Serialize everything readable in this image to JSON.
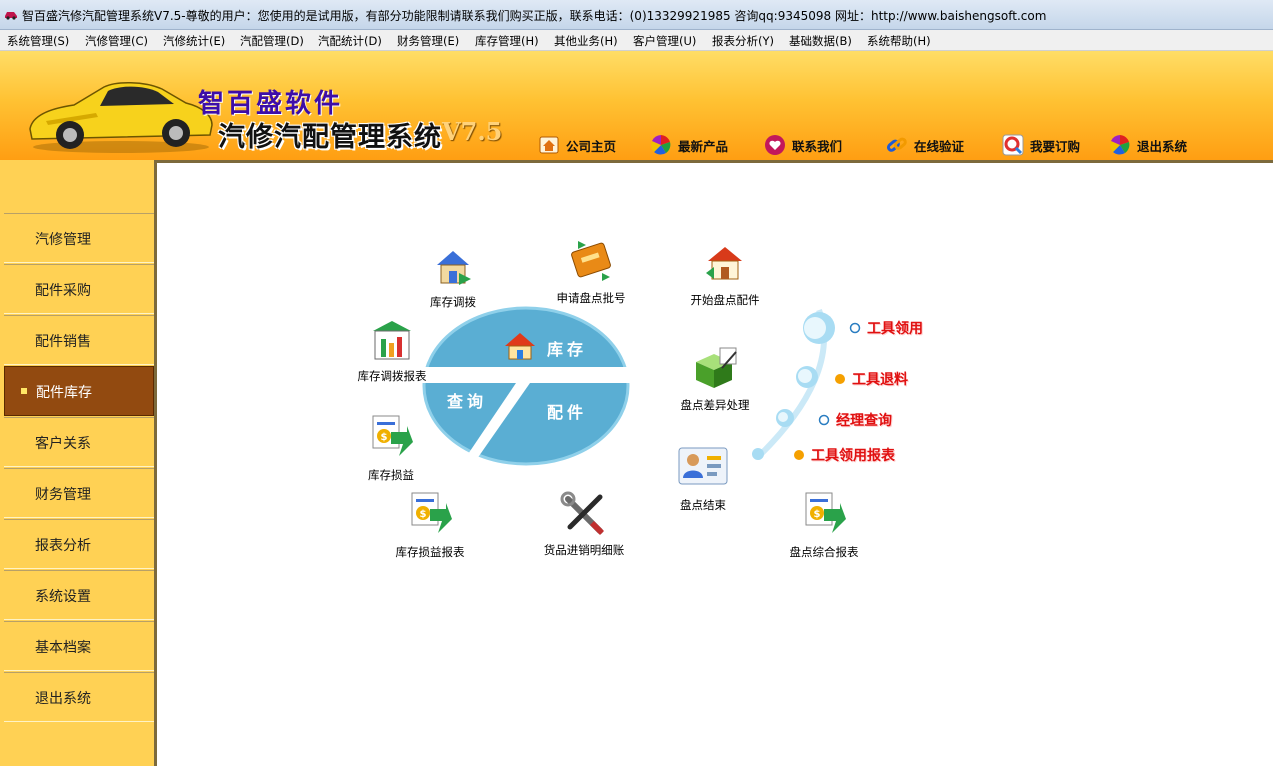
{
  "window": {
    "title": "智百盛汽修汽配管理系统V7.5-尊敬的用户：您使用的是试用版，有部分功能限制请联系我们购买正版，联系电话：(0)13329921985 咨询qq:9345098 网址：http://www.baishengsoft.com"
  },
  "menu": [
    "系统管理(S)",
    "汽修管理(C)",
    "汽修统计(E)",
    "汽配管理(D)",
    "汽配统计(D)",
    "财务管理(E)",
    "库存管理(H)",
    "其他业务(H)",
    "客户管理(U)",
    "报表分析(Y)",
    "基础数据(B)",
    "系统帮助(H)"
  ],
  "banner": {
    "brand": "智百盛软件",
    "system_name": "汽修汽配管理系统",
    "version": "V7.5",
    "nav": [
      {
        "label": "公司主页",
        "icon": "home-icon"
      },
      {
        "label": "最新产品",
        "icon": "pinwheel-icon"
      },
      {
        "label": "联系我们",
        "icon": "heart-icon"
      },
      {
        "label": "在线验证",
        "icon": "chain-link-icon"
      },
      {
        "label": "我要订购",
        "icon": "magnifier-icon"
      },
      {
        "label": "退出系统",
        "icon": "pinwheel-icon"
      }
    ]
  },
  "sidebar": {
    "items": [
      "汽修管理",
      "配件采购",
      "配件销售",
      "配件库存",
      "客户关系",
      "财务管理",
      "报表分析",
      "系统设置",
      "基本档案",
      "退出系统"
    ],
    "active_index": 3
  },
  "content": {
    "icons": [
      {
        "label": "库存调拨",
        "icon": "house-transfer-icon"
      },
      {
        "label": "申请盘点批号",
        "icon": "ticket-icon"
      },
      {
        "label": "开始盘点配件",
        "icon": "house-arrow-icon"
      },
      {
        "label": "库存调拨报表",
        "icon": "bar-chart-icon"
      },
      {
        "label": "盘点差异处理",
        "icon": "box-pen-icon"
      },
      {
        "label": "库存损益",
        "icon": "dollar-arrow-icon"
      },
      {
        "label": "盘点结束",
        "icon": "person-card-icon"
      },
      {
        "label": "库存损益报表",
        "icon": "dollar-arrow-icon"
      },
      {
        "label": "货品进销明细账",
        "icon": "tools-icon"
      },
      {
        "label": "盘点综合报表",
        "icon": "dollar-arrow-icon"
      }
    ],
    "hub": {
      "top": "库存",
      "left": "查询",
      "right": "配件"
    },
    "quick_links": [
      "工具领用",
      "工具退料",
      "经理查询",
      "工具领用报表"
    ]
  },
  "colors": {
    "banner_top": "#ffdd66",
    "banner_bottom": "#ff9e12",
    "sidebar_bg": "#ffd154",
    "sidebar_active": "#924a10",
    "hub_blue": "#5aaed3",
    "quick_link_red": "#e01010"
  }
}
